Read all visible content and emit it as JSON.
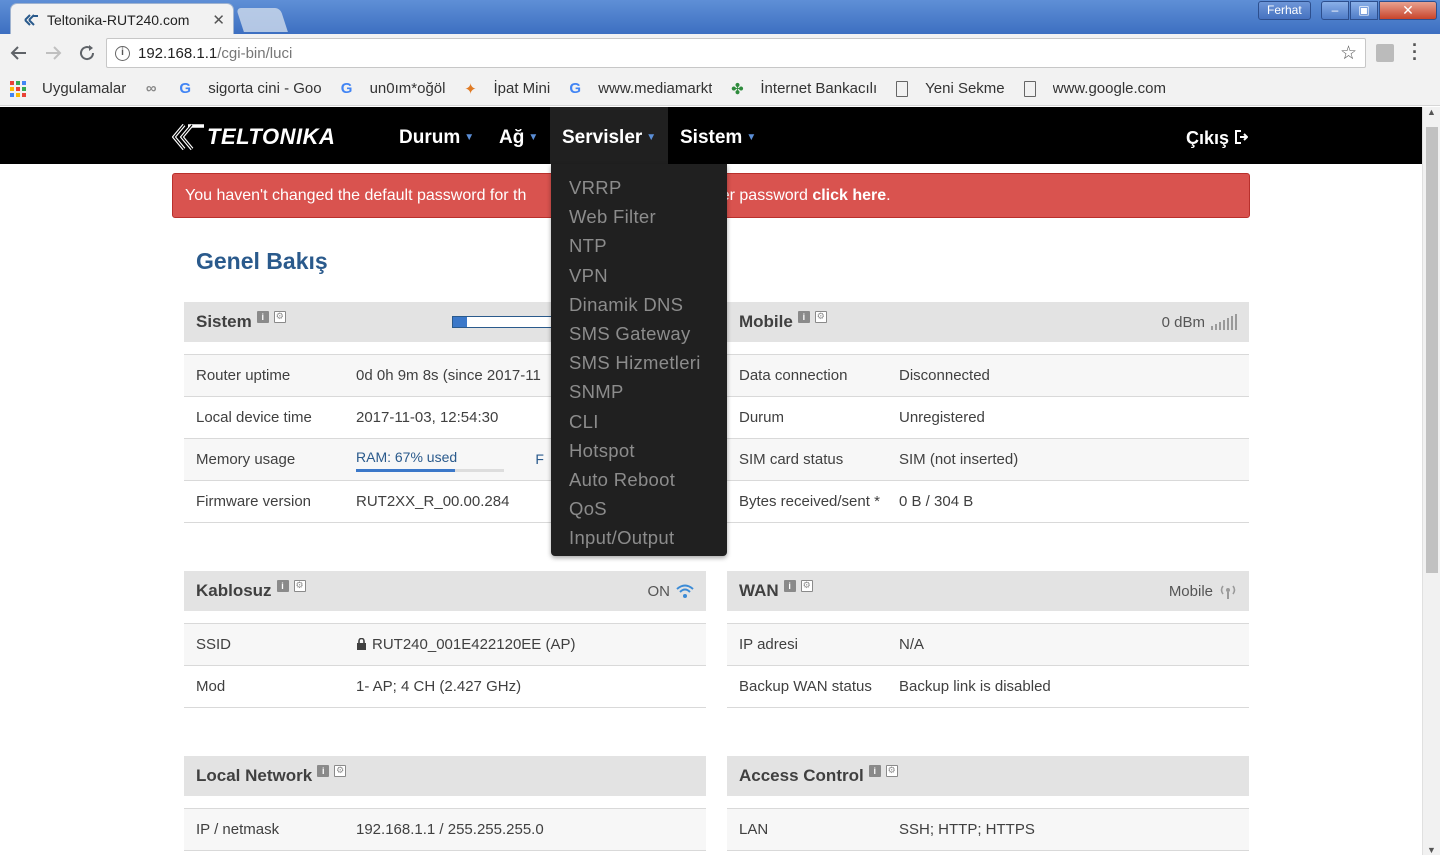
{
  "browser": {
    "tab_title": "Teltonika-RUT240.com",
    "user_label": "Ferhat",
    "url_host": "192.168.1.1",
    "url_path": "/cgi-bin/luci",
    "bookmarks": [
      {
        "label": "Uygulamalar",
        "icon": "apps-icon"
      },
      {
        "label": "",
        "icon": "link-icon"
      },
      {
        "label": "sigorta cini - Goo",
        "icon": "google-icon"
      },
      {
        "label": "un0ım*oğöl",
        "icon": "google-icon"
      },
      {
        "label": "İpat Mini",
        "icon": "pinwheel-icon"
      },
      {
        "label": "www.mediamarkt",
        "icon": "google-icon"
      },
      {
        "label": "İnternet Bankacılı",
        "icon": "clover-icon"
      },
      {
        "label": "Yeni Sekme",
        "icon": "page-icon"
      },
      {
        "label": "www.google.com",
        "icon": "page-icon"
      }
    ]
  },
  "header": {
    "logo": "TELTONIKA",
    "menu": [
      "Durum",
      "Ağ",
      "Servisler",
      "Sistem"
    ],
    "logout": "Çıkış"
  },
  "alert": {
    "text_before": "You haven't changed the default password for th",
    "text_after": "uter password ",
    "link": "click here",
    "end": "."
  },
  "page_title": "Genel Bakış",
  "dropdown": [
    "VRRP",
    "Web Filter",
    "NTP",
    "VPN",
    "Dinamik DNS",
    "SMS Gateway",
    "SMS Hizmetleri",
    "SNMP",
    "CLI",
    "Hotspot",
    "Auto Reboot",
    "QoS",
    "Input/Output"
  ],
  "panels": {
    "sistem": {
      "title": "Sistem",
      "cpu_fraction": 0.13,
      "rows": [
        {
          "k": "Router uptime",
          "v": "0d 0h 9m 8s (since 2017-11"
        },
        {
          "k": "Local device time",
          "v": "2017-11-03, 12:54:30"
        },
        {
          "k": "Memory usage",
          "v": "RAM: 67% used",
          "extra": "F"
        },
        {
          "k": "Firmware version",
          "v": "RUT2XX_R_00.00.284"
        }
      ],
      "ram_used_fraction": 0.67
    },
    "mobile": {
      "title": "Mobile",
      "signal": "0 dBm",
      "rows": [
        {
          "k": "Data connection",
          "v": "Disconnected"
        },
        {
          "k": "Durum",
          "v": "Unregistered"
        },
        {
          "k": "SIM card status",
          "v": "SIM (not inserted)"
        },
        {
          "k": "Bytes received/sent *",
          "v": "0 B / 304 B"
        }
      ]
    },
    "kablosuz": {
      "title": "Kablosuz",
      "status": "ON",
      "rows": [
        {
          "k": "SSID",
          "v": "RUT240_001E422120EE (AP)"
        },
        {
          "k": "Mod",
          "v": "1- AP; 4 CH (2.427 GHz)"
        }
      ]
    },
    "wan": {
      "title": "WAN",
      "status": "Mobile",
      "rows": [
        {
          "k": "IP adresi",
          "v": "N/A"
        },
        {
          "k": "Backup WAN status",
          "v": "Backup link is disabled"
        }
      ]
    },
    "local": {
      "title": "Local Network",
      "rows": [
        {
          "k": "IP / netmask",
          "v": "192.168.1.1 / 255.255.255.0"
        }
      ]
    },
    "access": {
      "title": "Access Control",
      "rows": [
        {
          "k": "LAN",
          "v": "SSH; HTTP; HTTPS"
        }
      ]
    }
  }
}
